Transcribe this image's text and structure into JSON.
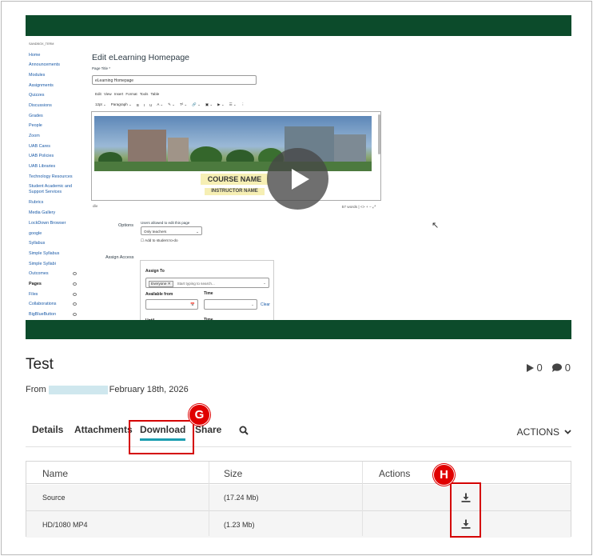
{
  "video": {
    "course_label": "SANDBOX_TERM",
    "sidebar": [
      {
        "label": "Home",
        "eye": false
      },
      {
        "label": "Announcements",
        "eye": false
      },
      {
        "label": "Modules",
        "eye": false
      },
      {
        "label": "Assignments",
        "eye": false
      },
      {
        "label": "Quizzes",
        "eye": false
      },
      {
        "label": "Discussions",
        "eye": false
      },
      {
        "label": "Grades",
        "eye": false
      },
      {
        "label": "People",
        "eye": false
      },
      {
        "label": "Zoom",
        "eye": false
      },
      {
        "label": "UAB Cares",
        "eye": false
      },
      {
        "label": "UAB Policies",
        "eye": false
      },
      {
        "label": "UAB Libraries",
        "eye": false
      },
      {
        "label": "Technology Resources",
        "eye": false
      },
      {
        "label": "Student Academic and Support Services",
        "eye": false
      },
      {
        "label": "Rubrics",
        "eye": false
      },
      {
        "label": "Media Gallery",
        "eye": false
      },
      {
        "label": "LockDown Browser",
        "eye": false
      },
      {
        "label": "google",
        "eye": false
      },
      {
        "label": "Syllabus",
        "eye": false
      },
      {
        "label": "Simple Syllabus",
        "eye": false
      },
      {
        "label": "Simple Syllabi",
        "eye": false
      },
      {
        "label": "Outcomes",
        "eye": true
      },
      {
        "label": "Pages",
        "eye": true
      },
      {
        "label": "Files",
        "eye": true
      },
      {
        "label": "Collaborations",
        "eye": true
      },
      {
        "label": "BigBlueButton",
        "eye": true
      }
    ],
    "active_sidebar": "Pages",
    "editor_title": "Edit eLearning Homepage",
    "page_title_label": "Page Title *",
    "page_title_value": "eLearning Homepage",
    "menubar": "Edit  View  Insert  Format  Tools  Table",
    "toolbar": [
      "12pt ⌄",
      "Paragraph ⌄",
      "B",
      "I",
      "U",
      "A ⌄",
      "✎ ⌄",
      "T² ⌄",
      "🔗 ⌄",
      "▣ ⌄",
      "▶ ⌄",
      "☰ ⌄",
      "⋮"
    ],
    "course_name": "COURSE NAME",
    "instructor_name": "INSTRUCTOR NAME",
    "status_left": "div",
    "status_right": "57 words  |  <>  +  −  ⤢",
    "options_label": "Options",
    "users_allowed_label": "Users allowed to edit this page",
    "users_allowed_value": "Only teachers",
    "add_todo": "Add to student to-do",
    "assign_access_label": "Assign Access",
    "assign_to_label": "Assign To",
    "everyone_pill": "Everyone",
    "assign_placeholder": "Start typing to search...",
    "available_from": "Available from",
    "time_label": "Time",
    "clear_label": "Clear",
    "until_label": "Until",
    "time_label_2": "Time"
  },
  "video_title": "Test",
  "plays": "0",
  "comments": "0",
  "from_label": "From",
  "date": "February 18th, 2026",
  "tabs": {
    "details": "Details",
    "attachments": "Attachments",
    "download": "Download",
    "share": "Share"
  },
  "actions_label": "ACTIONS",
  "markers": {
    "g": "G",
    "h": "H"
  },
  "table": {
    "headers": {
      "name": "Name",
      "size": "Size",
      "actions": "Actions"
    },
    "rows": [
      {
        "name": "Source",
        "size": "(17.24 Mb)"
      },
      {
        "name": "HD/1080 MP4",
        "size": "(1.23 Mb)"
      }
    ]
  },
  "colors": {
    "brand_green": "#0c4b2b",
    "tab_underline": "#1a9db0",
    "highlight_red": "#d40000"
  }
}
